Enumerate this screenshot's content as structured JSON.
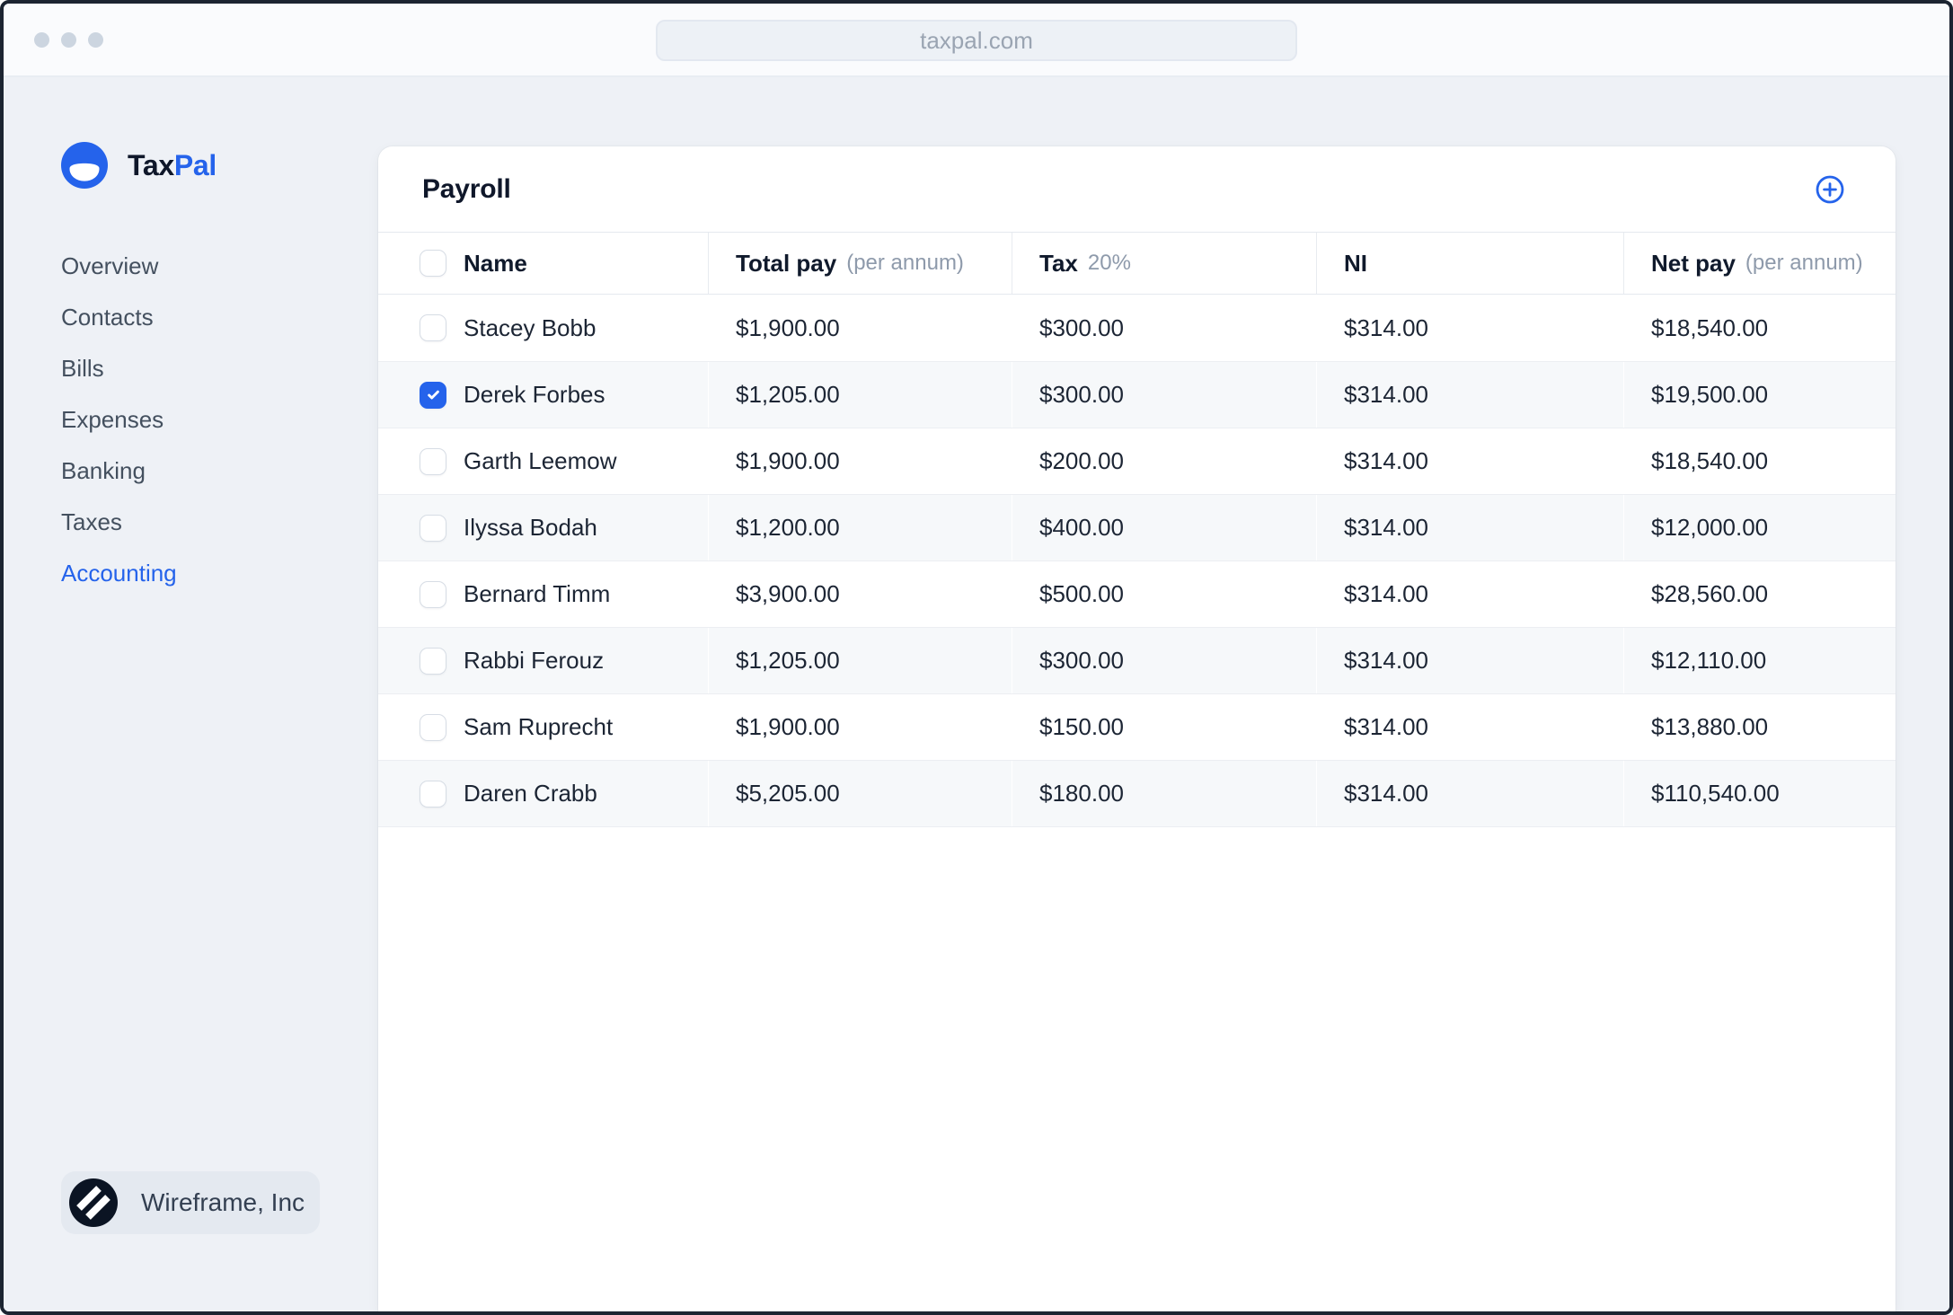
{
  "browser": {
    "url": "taxpal.com"
  },
  "brand": {
    "name_primary": "Tax",
    "name_secondary": "Pal"
  },
  "sidebar": {
    "items": [
      {
        "label": "Overview",
        "active": false
      },
      {
        "label": "Contacts",
        "active": false
      },
      {
        "label": "Bills",
        "active": false
      },
      {
        "label": "Expenses",
        "active": false
      },
      {
        "label": "Banking",
        "active": false
      },
      {
        "label": "Taxes",
        "active": false
      },
      {
        "label": "Accounting",
        "active": true
      }
    ],
    "footer": {
      "company": "Wireframe, Inc"
    }
  },
  "main": {
    "title": "Payroll",
    "table": {
      "select_all_checked": false,
      "columns": [
        {
          "label": "Name",
          "sub": ""
        },
        {
          "label": "Total pay",
          "sub": "(per annum)"
        },
        {
          "label": "Tax",
          "sub": "20%"
        },
        {
          "label": "NI",
          "sub": ""
        },
        {
          "label": "Net pay",
          "sub": "(per annum)"
        }
      ],
      "rows": [
        {
          "checked": false,
          "name": "Stacey Bobb",
          "total_pay": "$1,900.00",
          "tax": "$300.00",
          "ni": "$314.00",
          "net_pay": "$18,540.00"
        },
        {
          "checked": true,
          "name": "Derek Forbes",
          "total_pay": "$1,205.00",
          "tax": "$300.00",
          "ni": "$314.00",
          "net_pay": "$19,500.00"
        },
        {
          "checked": false,
          "name": "Garth Leemow",
          "total_pay": "$1,900.00",
          "tax": "$200.00",
          "ni": "$314.00",
          "net_pay": "$18,540.00"
        },
        {
          "checked": false,
          "name": "Ilyssa Bodah",
          "total_pay": "$1,200.00",
          "tax": "$400.00",
          "ni": "$314.00",
          "net_pay": "$12,000.00"
        },
        {
          "checked": false,
          "name": "Bernard Timm",
          "total_pay": "$3,900.00",
          "tax": "$500.00",
          "ni": "$314.00",
          "net_pay": "$28,560.00"
        },
        {
          "checked": false,
          "name": "Rabbi Ferouz",
          "total_pay": "$1,205.00",
          "tax": "$300.00",
          "ni": "$314.00",
          "net_pay": "$12,110.00"
        },
        {
          "checked": false,
          "name": "Sam Ruprecht",
          "total_pay": "$1,900.00",
          "tax": "$150.00",
          "ni": "$314.00",
          "net_pay": "$13,880.00"
        },
        {
          "checked": false,
          "name": "Daren Crabb",
          "total_pay": "$5,205.00",
          "tax": "$180.00",
          "ni": "$314.00",
          "net_pay": "$110,540.00"
        }
      ]
    }
  },
  "icons": {
    "logo": "taxpal-circle-logo",
    "add": "plus-circle-icon",
    "org": "wireframe-slash-logo",
    "check": "checkmark-icon"
  },
  "colors": {
    "accent": "#2563eb",
    "heading": "#0f172a",
    "body_text": "#1c2534",
    "muted": "#8e9aab",
    "page_bg": "#eef1f6",
    "stripe_bg": "#f6f8fa",
    "line": "#eceef2",
    "org_logo_bg": "#0b1423"
  }
}
